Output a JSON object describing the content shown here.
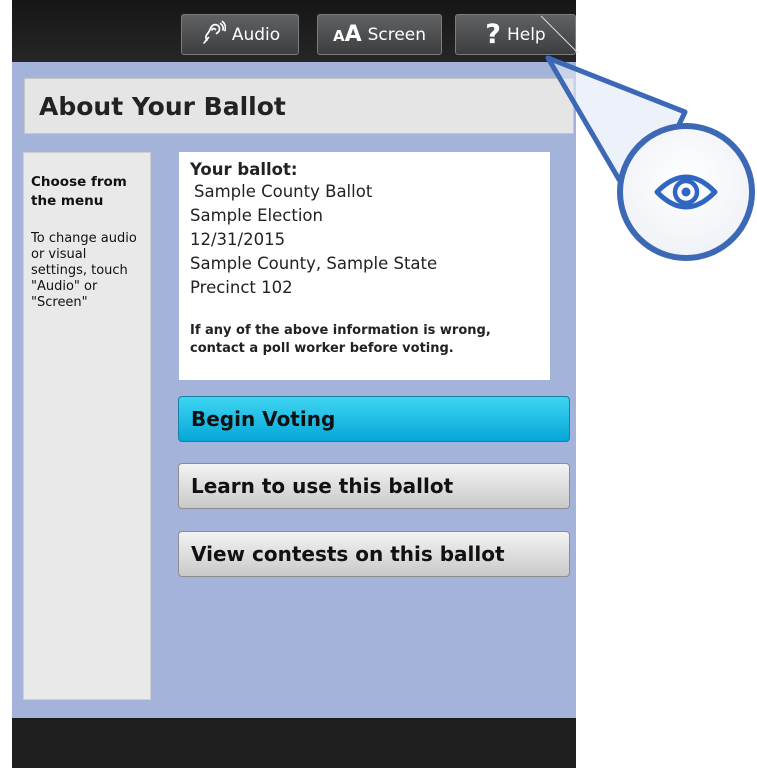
{
  "toolbar": {
    "audio_label": "Audio",
    "screen_prefix": "A",
    "screen_big": "A",
    "screen_label": "Screen",
    "help_label": "Help"
  },
  "page": {
    "title": "About Your Ballot"
  },
  "sidebar": {
    "heading": "Choose from the menu",
    "text": "To change audio or visual settings, touch \"Audio\" or \"Screen\""
  },
  "ballot": {
    "heading": "Your ballot:",
    "name": "Sample County Ballot",
    "election": "Sample Election",
    "date": "12/31/2015",
    "location": "Sample County, Sample State",
    "precinct": "Precinct 102",
    "warning": "If any of the above information is wrong, contact a poll worker before voting."
  },
  "actions": {
    "begin": "Begin Voting",
    "learn": "Learn to use this ballot",
    "view": "View contests on this ballot"
  },
  "colors": {
    "background": "#a3b3da",
    "begin_button": "#0fb3df",
    "callout_blue": "#3c68b5",
    "eye_icon": "#2f66c1"
  },
  "icons": {
    "audio": "hearing-ear-icon",
    "screen": "text-size-icon",
    "help": "question-mark-icon",
    "callout": "eye-icon"
  }
}
